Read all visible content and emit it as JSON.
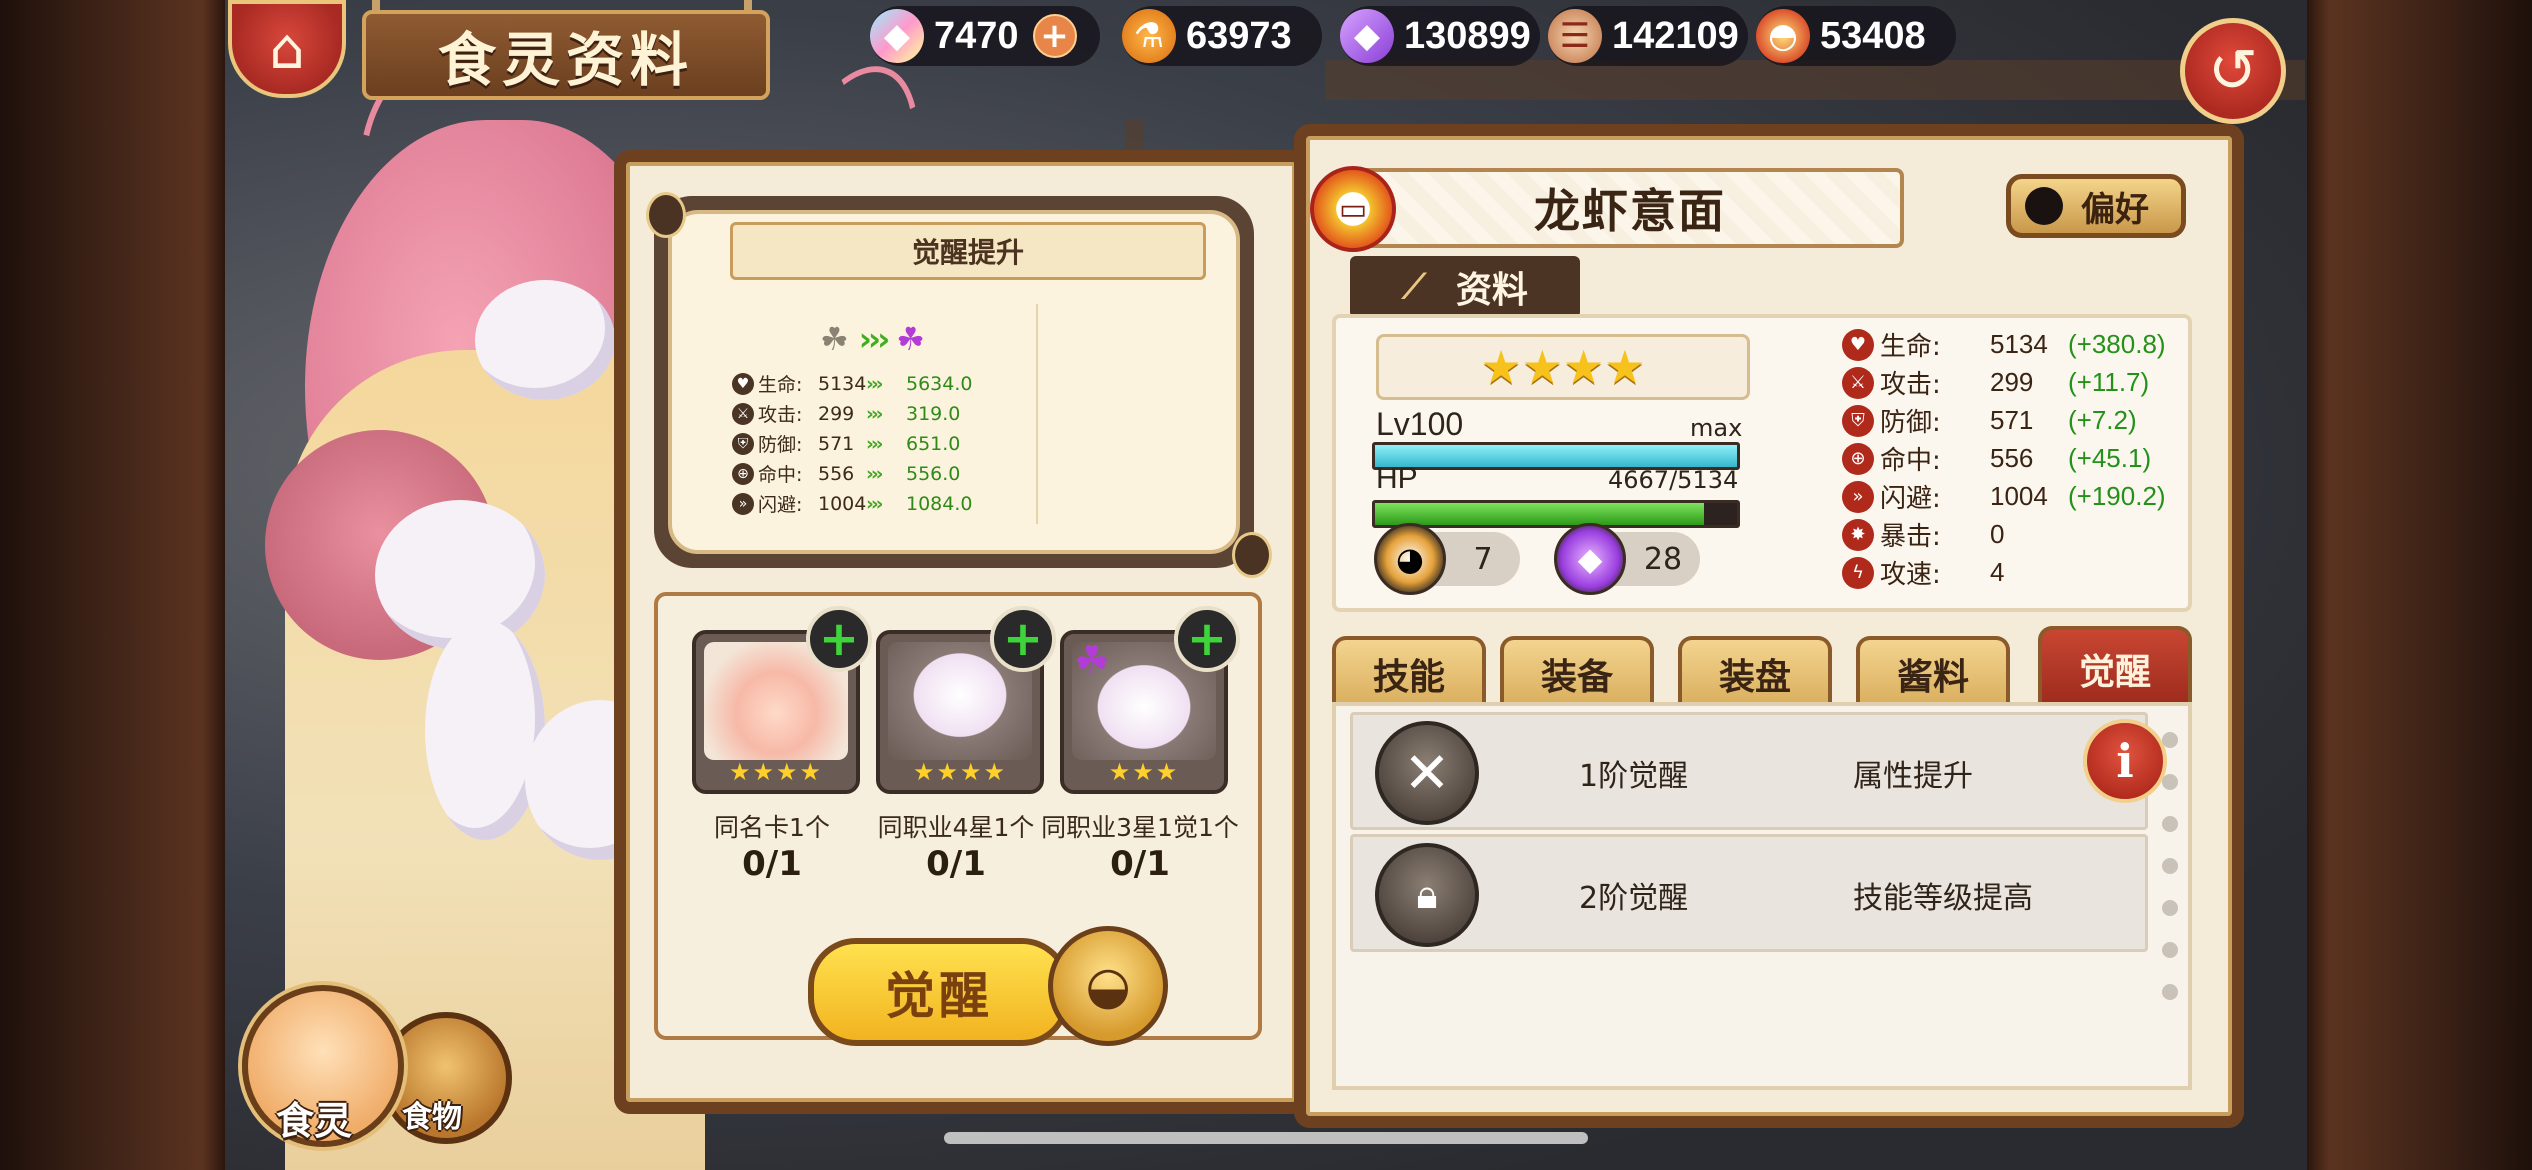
{
  "header": {
    "title": "食灵资料",
    "resources": [
      {
        "icon": "rainbow-crystal-icon",
        "value": "7470",
        "has_plus": true
      },
      {
        "icon": "gold-potion-icon",
        "value": "63973",
        "has_plus": false
      },
      {
        "icon": "purple-crystal-icon",
        "value": "130899",
        "has_plus": false
      },
      {
        "icon": "meat-scroll-icon",
        "value": "142109",
        "has_plus": false
      },
      {
        "icon": "seasoning-bowl-icon",
        "value": "53408",
        "has_plus": false
      }
    ]
  },
  "awaken_preview": {
    "title": "觉醒提升",
    "stats": [
      {
        "icon": "hp-icon",
        "label": "生命:",
        "old": "5134",
        "new": "5634.0"
      },
      {
        "icon": "attack-icon",
        "label": "攻击:",
        "old": "299",
        "new": "319.0"
      },
      {
        "icon": "defense-icon",
        "label": "防御:",
        "old": "571",
        "new": "651.0"
      },
      {
        "icon": "accuracy-icon",
        "label": "命中:",
        "old": "556",
        "new": "556.0"
      },
      {
        "icon": "evasion-icon",
        "label": "闪避:",
        "old": "1004",
        "new": "1084.0"
      }
    ]
  },
  "requirements": [
    {
      "label": "同名卡1个",
      "count": "0/1",
      "stars": "★★★★"
    },
    {
      "label": "同职业4星1个",
      "count": "0/1",
      "stars": "★★★★"
    },
    {
      "label": "同职业3星1觉1个",
      "count": "0/1",
      "stars": "★★★"
    }
  ],
  "awaken_button": "觉醒",
  "food_soul": {
    "name": "龙虾意面",
    "preference_label": "偏好",
    "tab_label": "资料",
    "stars": "★★★★",
    "level": "Lv100",
    "level_max": "max",
    "level_progress": 1.0,
    "hp_label": "HP",
    "hp_value": "4667/5134",
    "hp_progress": 0.909,
    "item1_count": "7",
    "item2_count": "28"
  },
  "stats": [
    {
      "label": "生命:",
      "value": "5134",
      "bonus": "(+380.8)"
    },
    {
      "label": "攻击:",
      "value": "299",
      "bonus": "(+11.7)"
    },
    {
      "label": "防御:",
      "value": "571",
      "bonus": "(+7.2)"
    },
    {
      "label": "命中:",
      "value": "556",
      "bonus": "(+45.1)"
    },
    {
      "label": "闪避:",
      "value": "1004",
      "bonus": "(+190.2)"
    },
    {
      "label": "暴击:",
      "value": "0",
      "bonus": ""
    },
    {
      "label": "攻速:",
      "value": "4",
      "bonus": ""
    }
  ],
  "tabs": [
    "技能",
    "装备",
    "装盘",
    "酱料",
    "觉醒"
  ],
  "active_tab": "觉醒",
  "awaken_list": [
    {
      "level": "1阶觉醒",
      "effect": "属性提升",
      "locked": false
    },
    {
      "level": "2阶觉醒",
      "effect": "技能等级提高",
      "locked": true
    }
  ],
  "bottom_nav": {
    "food_soul_label": "食灵",
    "food_label": "食物"
  },
  "colors": {
    "accent_red": "#b02a1c",
    "gold": "#f2b320",
    "exp_bar": "#4fd0e0",
    "hp_bar": "#3fbe2c",
    "bonus_green": "#24911a"
  }
}
